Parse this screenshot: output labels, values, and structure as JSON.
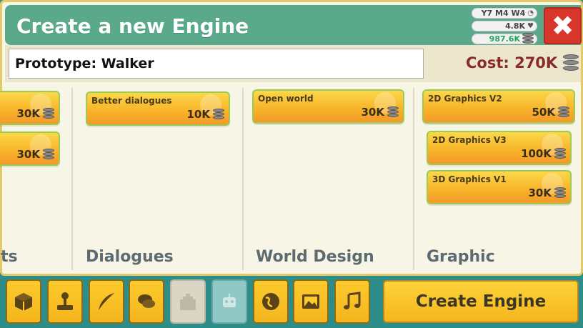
{
  "header": {
    "title": "Create a new Engine",
    "stats": [
      {
        "value": "Y7 M4 W4",
        "icon": "clock-icon"
      },
      {
        "value": "4.8K",
        "icon": "heart-icon"
      },
      {
        "value": "987.6K",
        "icon": "coins-icon"
      }
    ],
    "close_icon": "close-icon"
  },
  "engine": {
    "name": "Prototype: Walker",
    "cost_label": "Cost: 270K"
  },
  "columns": [
    {
      "title": "ts",
      "cards": [
        {
          "name": "",
          "value": "30K"
        },
        {
          "name": "",
          "value": "30K"
        }
      ]
    },
    {
      "title": "Dialogues",
      "cards": [
        {
          "name": "Better dialogues",
          "value": "10K"
        }
      ]
    },
    {
      "title": "World Design",
      "cards": [
        {
          "name": "Open world",
          "value": "30K"
        }
      ]
    },
    {
      "title": "Graphic",
      "cards": [
        {
          "name": "2D Graphics V2",
          "value": "50K"
        },
        {
          "name": "2D Graphics V3",
          "value": "100K"
        },
        {
          "name": "3D Graphics V1",
          "value": "30K"
        }
      ]
    }
  ],
  "tabs": [
    {
      "icon": "box-icon",
      "state": "active"
    },
    {
      "icon": "joystick-icon",
      "state": "active"
    },
    {
      "icon": "feather-icon",
      "state": "active"
    },
    {
      "icon": "speech-bubbles-icon",
      "state": "active"
    },
    {
      "icon": "castle-icon",
      "state": "disabled"
    },
    {
      "icon": "robot-icon",
      "state": "disabled"
    },
    {
      "icon": "globe-icon",
      "state": "active"
    },
    {
      "icon": "picture-icon",
      "state": "active"
    },
    {
      "icon": "music-note-icon",
      "state": "active"
    }
  ],
  "actions": {
    "create_label": "Create Engine"
  },
  "colors": {
    "titlebar": "#5aa98a",
    "cost": "#8b2a2a",
    "money": "#25a55a",
    "close": "#d8362b",
    "card_gradient_top": "#fbd84a",
    "card_gradient_bottom": "#f39a2a"
  }
}
